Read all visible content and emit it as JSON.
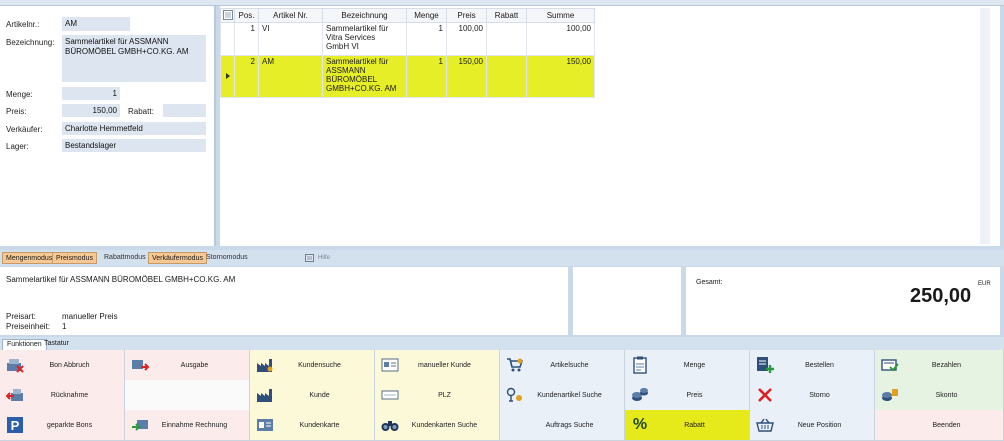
{
  "form": {
    "artikelnr_label": "Artikelnr.:",
    "artikelnr_value": "AM",
    "bezeichnung_label": "Bezeichnung:",
    "bezeichnung_value": "Sammelartikel für ASSMANN BÜROMÖBEL GMBH+CO.KG. AM",
    "menge_label": "Menge:",
    "menge_value": "1",
    "preis_label": "Preis:",
    "preis_value": "150,00",
    "rabatt_label": "Rabatt:",
    "rabatt_value": "",
    "verkaeufer_label": "Verkäufer:",
    "verkaeufer_value": "Charlotte Hemmetfeld",
    "lager_label": "Lager:",
    "lager_value": "Bestandslager"
  },
  "grid": {
    "headers": [
      "Pos.",
      "Artikel Nr.",
      "Bezeichnung",
      "Menge",
      "Preis",
      "Rabatt",
      "Summe"
    ],
    "rows": [
      {
        "pos": "1",
        "artikel": "VI",
        "bez_lines": [
          "Sammelartikel für",
          "Vitra Services",
          "GmbH VI"
        ],
        "menge": "1",
        "preis": "100,00",
        "rabatt": "",
        "summe": "100,00"
      },
      {
        "pos": "2",
        "artikel": "AM",
        "bez_lines": [
          "Sammelartikel für",
          "ASSMANN",
          "BÜROMÖBEL",
          "GMBH+CO.KG. AM"
        ],
        "menge": "1",
        "preis": "150,00",
        "rabatt": "",
        "summe": "150,00"
      }
    ]
  },
  "modes": {
    "mengenmodus": "Mengenmodus",
    "preismodus": "Preismodus",
    "rabattmodus": "Rabattmodus",
    "verkaeufermodus": "Verkäufermodus",
    "stornomodus": "Stornomodus",
    "kb": "Hilfe"
  },
  "info": {
    "description": "Sammelartikel für ASSMANN BÜROMÖBEL GMBH+CO.KG. AM",
    "preisart_label": "Preisart:",
    "preisart_value": "manueller Preis",
    "preiseinheit_label": "Preiseinheit:",
    "preiseinheit_value": "1",
    "gesamt_label": "Gesamt:",
    "currency": "EUR",
    "total": "250,00"
  },
  "tabs": {
    "funktionen": "Funktionen",
    "tastatur": "Tastatur"
  },
  "buttons": {
    "bon_abbruch": "Bon Abbruch",
    "ausgabe": "Ausgabe",
    "kundensuche": "Kundensuche",
    "manueller_kunde": "manueller Kunde",
    "artikelsuche": "Artikelsuche",
    "menge": "Menge",
    "bestellen": "Bestellen",
    "bezahlen": "Bezahlen",
    "ruecknahme": "Rücknahme",
    "kunde": "Kunde",
    "plz": "PLZ",
    "kundenartikel_suche": "Kundenartikel Suche",
    "preis": "Preis",
    "storno": "Storno",
    "skonto": "Skonto",
    "geparkte_bons": "geparkte Bons",
    "einnahme_rechnung": "Einnahme Rechnung",
    "kundenkarte": "Kundenkarte",
    "kundenkarten_suche": "Kundenkarten Suche",
    "auftrags_suche": "Auftrags Suche",
    "rabatt": "Rabatt",
    "neue_position": "Neue Position",
    "beenden": "Beenden"
  }
}
